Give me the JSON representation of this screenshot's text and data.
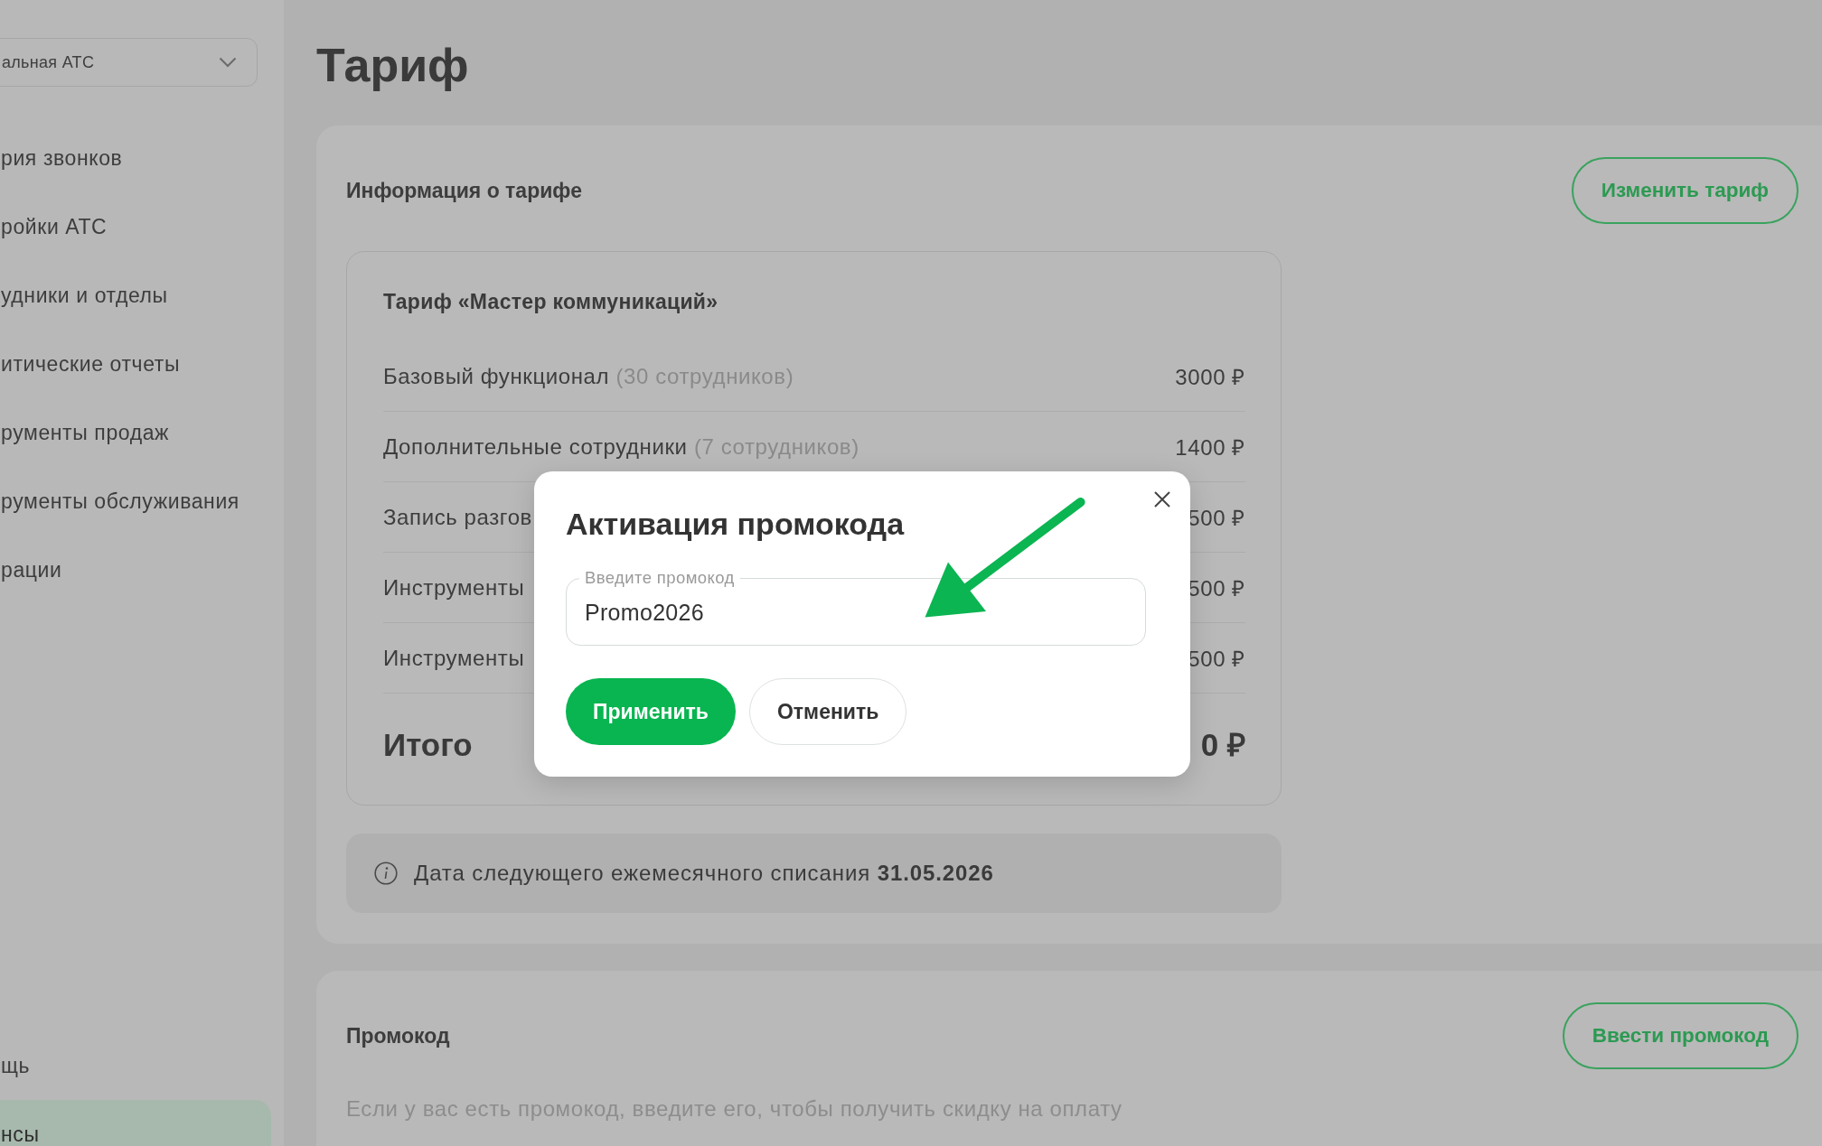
{
  "sidebar": {
    "account_select": {
      "value": "альная АТС"
    },
    "items": [
      {
        "label": "рия звонков",
        "selected": false
      },
      {
        "label": "ройки АТС",
        "selected": false
      },
      {
        "label": "удники и отделы",
        "selected": false
      },
      {
        "label": "итические отчеты",
        "selected": false
      },
      {
        "label": "рументы продаж",
        "selected": false
      },
      {
        "label": "рументы обслуживания",
        "selected": false
      },
      {
        "label": "рации",
        "selected": false
      }
    ],
    "bottom_items": [
      {
        "label": "щь",
        "selected": false
      },
      {
        "label": "нсы",
        "selected": true
      }
    ]
  },
  "page": {
    "title": "Тариф"
  },
  "tariff_card": {
    "title": "Информация о тарифе",
    "change_button": "Изменить тариф",
    "plan": {
      "name": "Тариф «Мастер коммуникаций»",
      "rows": [
        {
          "label": "Базовый функционал",
          "note": "(30 сотрудников)",
          "price": "3000 ₽"
        },
        {
          "label": "Дополнительные сотрудники",
          "note": "(7 сотрудников)",
          "price": "1400 ₽"
        },
        {
          "label": "Запись разгов",
          "price": "500 ₽"
        },
        {
          "label": "Инструменты",
          "price": "500 ₽"
        },
        {
          "label": "Инструменты",
          "price": "500 ₽"
        }
      ],
      "total": {
        "label": "Итого",
        "price": "0 ₽"
      }
    },
    "notice": "Дата следующего ежемесячного списания **31.05.2026**"
  },
  "promo_card": {
    "title": "Промокод",
    "button": "Ввести промокод",
    "description": "Если у вас есть промокод, введите его, чтобы получить скидку на оплату"
  },
  "dialog": {
    "title": "Активация промокода",
    "field": {
      "label": "Введите промокод",
      "value": "Promo2026"
    },
    "buttons": [
      {
        "label": "Применить",
        "kind": "primary"
      },
      {
        "label": "Отменить",
        "kind": "secondary"
      }
    ]
  }
}
